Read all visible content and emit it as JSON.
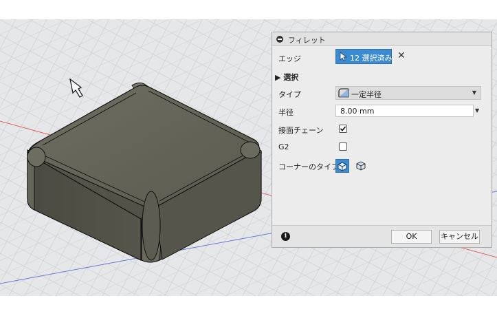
{
  "dialog": {
    "title": "フィレット",
    "edge_label": "エッジ",
    "edge_value": "12 選択済み",
    "clear_icon": "close-icon",
    "section_label": "選択",
    "type_label": "タイプ",
    "type_value": "一定半径",
    "radius_label": "半径",
    "radius_value": "8.00 mm",
    "tangent_chain_label": "接面チェーン",
    "tangent_chain_checked": true,
    "g2_label": "G2",
    "g2_checked": false,
    "corner_type_label": "コーナーのタイプ",
    "ok_label": "OK",
    "cancel_label": "キャンセル"
  },
  "colors": {
    "accent": "#3c8bd0",
    "model": "#5f5e53",
    "grid_x_axis": "#e06060",
    "grid_z_axis": "#6a78d8"
  },
  "icons": [
    "collapse-icon",
    "select-cursor-icon",
    "close-icon",
    "expand-triangle-icon",
    "constant-radius-icon",
    "dropdown-arrow-icon",
    "checkmark-icon",
    "corner-setback-icon",
    "corner-rolling-ball-icon",
    "info-icon",
    "hand-cursor-icon"
  ]
}
